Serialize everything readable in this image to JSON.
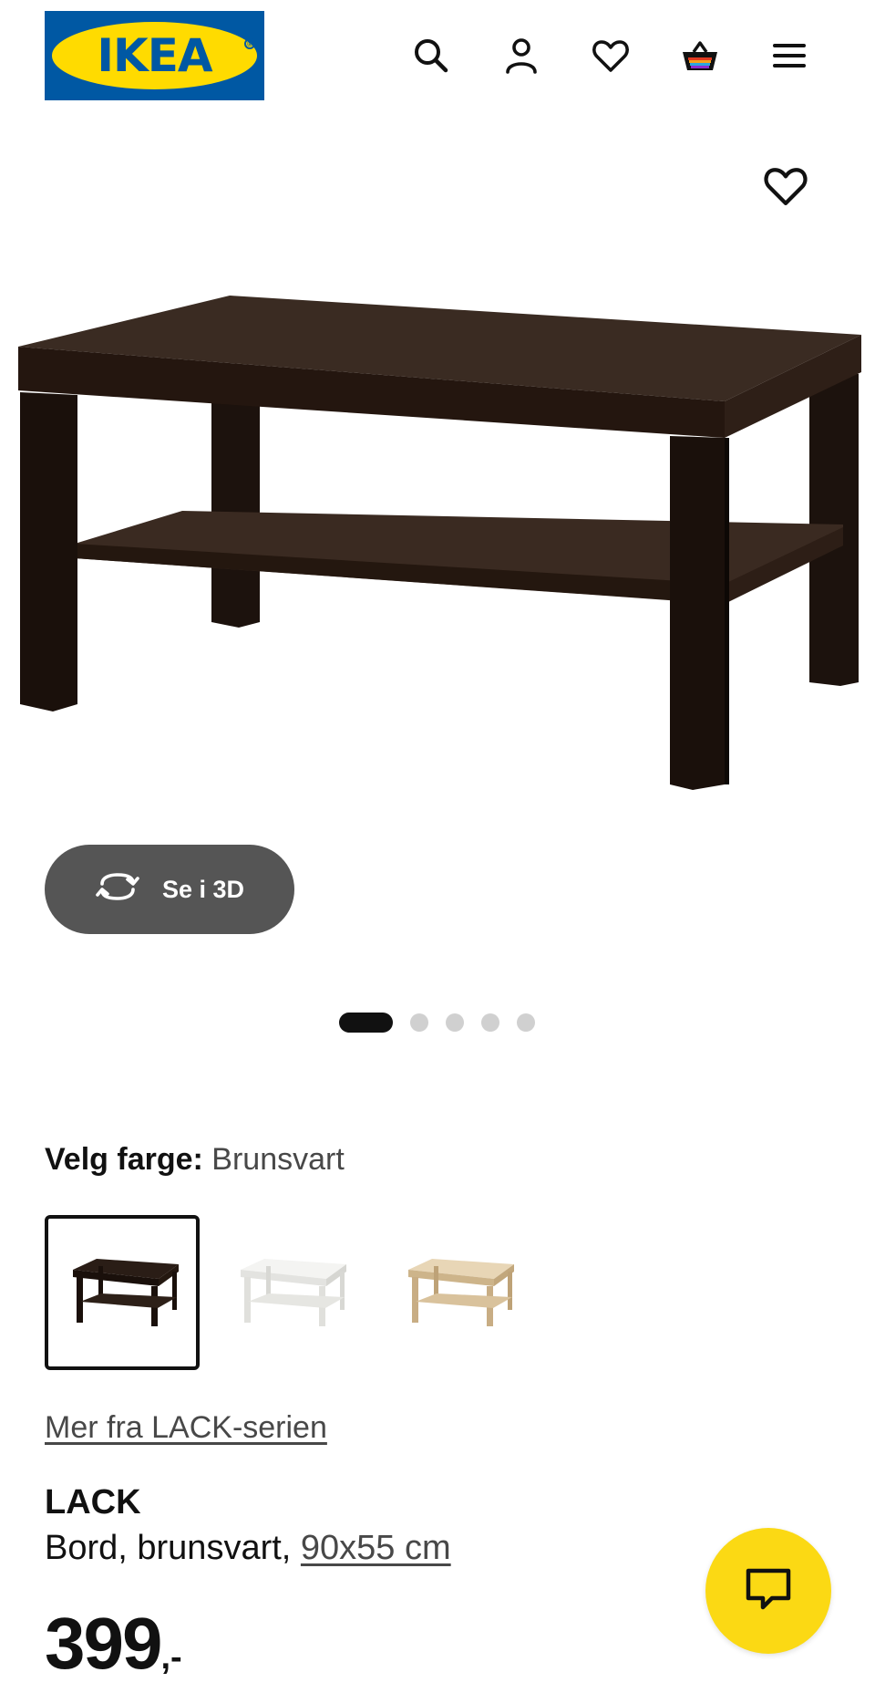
{
  "header": {
    "logo_text": "IKEA",
    "logo_mark": "®",
    "icons": [
      "search-icon",
      "profile-icon",
      "wishlist-icon",
      "cart-icon",
      "menu-icon"
    ]
  },
  "gallery": {
    "view_3d_label": "Se i 3D",
    "slide_count": 5,
    "active_slide": 1
  },
  "color": {
    "label": "Velg farge:",
    "selected_value": "Brunsvart",
    "swatches": [
      "Brunsvart",
      "Hvit",
      "Hvitbeiset eikemønstret"
    ]
  },
  "series_link": "Mer fra LACK-serien",
  "product": {
    "name": "LACK",
    "description": "Bord, brunsvart,",
    "dimensions": "90x55 cm",
    "price": "399",
    "price_suffix": ",-"
  },
  "colors": {
    "ikea_blue": "#0058a3",
    "ikea_yellow": "#ffdb00",
    "table_brown_black": "#2a1d16",
    "chat_yellow": "#fbd914",
    "button_3d_bg": "#555555"
  }
}
